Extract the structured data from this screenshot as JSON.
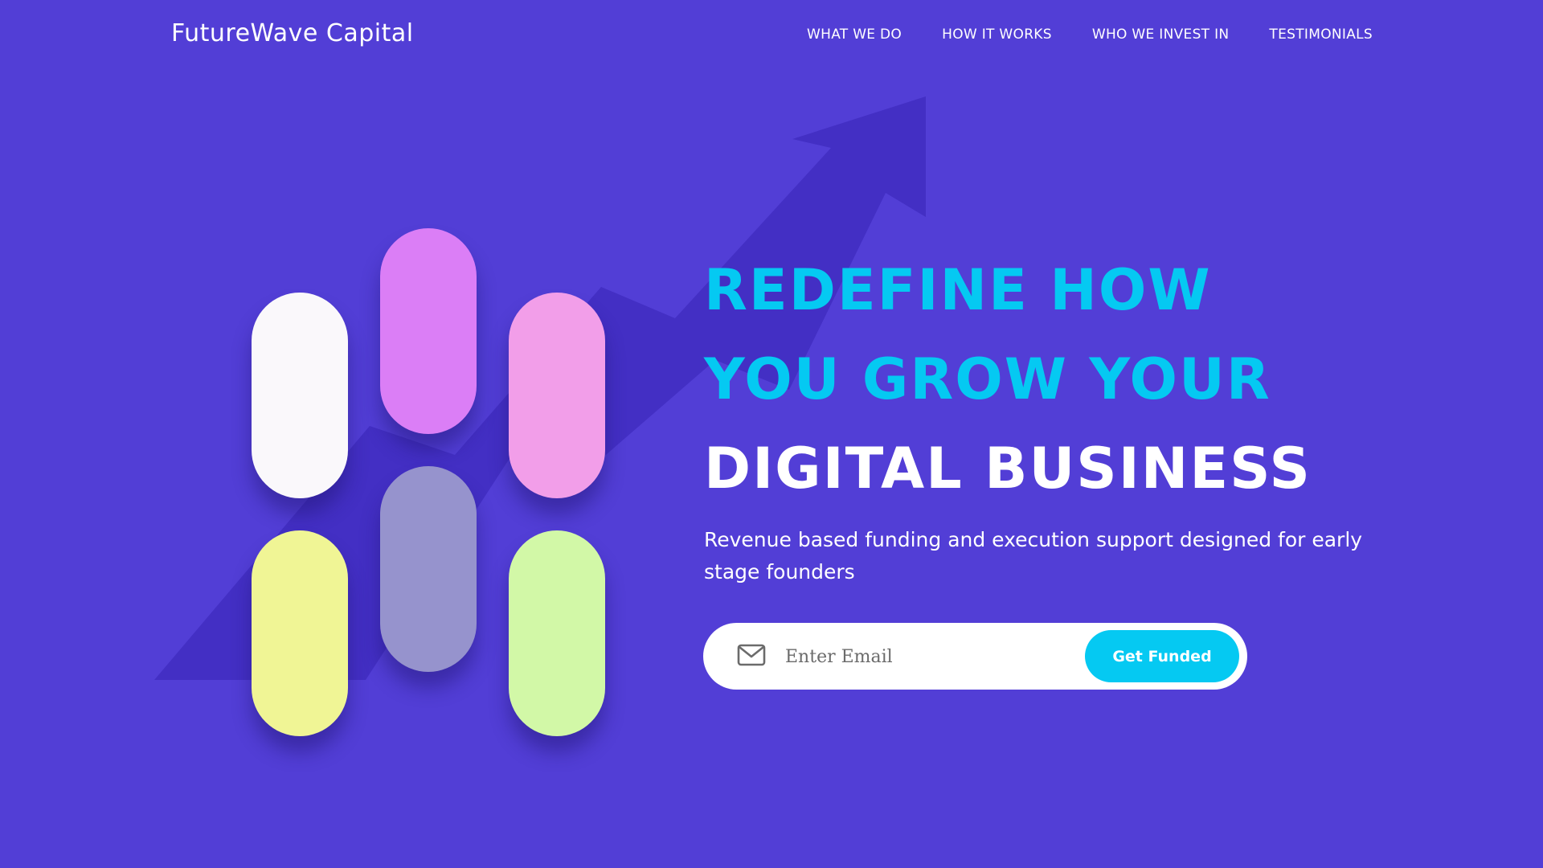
{
  "header": {
    "brand": "FutureWave Capital",
    "nav": [
      "WHAT WE DO",
      "HOW IT WORKS",
      "WHO WE INVEST IN",
      "TESTIMONIALS"
    ]
  },
  "hero": {
    "title_lines": [
      "REDEFINE HOW",
      "YOU GROW YOUR",
      "DIGITAL BUSINESS"
    ],
    "subtitle": "Revenue based funding and execution support designed for early stage founders",
    "form": {
      "email_placeholder": "Enter Email",
      "email_value": "",
      "icon": "mail-icon",
      "button_label": "Get Funded"
    }
  },
  "illustration": {
    "pill_colors": [
      "#faf8fb",
      "#db7ef6",
      "#f29ee9",
      "#f0f595",
      "#9693cd",
      "#d2f8a7"
    ],
    "arrow_color": "#432fc4"
  },
  "colors": {
    "background": "#523ed6",
    "accent": "#05c9f2",
    "text": "#ffffff"
  }
}
